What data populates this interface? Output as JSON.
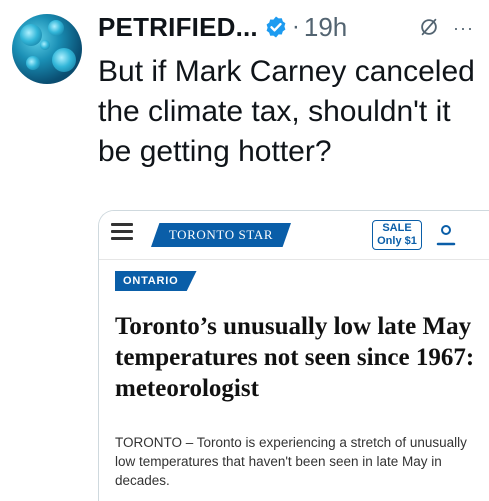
{
  "tweet": {
    "display_name": "PETRIFIED...",
    "separator": "·",
    "timestamp": "19h",
    "more_label": "···",
    "text": "But if Mark Carney canceled the climate tax, shouldn't it be getting hotter?"
  },
  "card": {
    "masthead": "TORONTO STAR",
    "sale_line1": "SALE",
    "sale_line2": "Only $1",
    "section": "ONTARIO",
    "headline": "Toronto’s unusually low late May temperatures not seen since 1967: meteorologist",
    "summary": "TORONTO – Toronto is experiencing a stretch of unusually low temperatures that haven't been seen in late May in decades."
  },
  "colors": {
    "verified_blue": "#1d9bf0",
    "star_blue": "#0a5ea8",
    "secondary_text": "#536471"
  },
  "icons": {
    "avatar": "virus-avatar",
    "verified": "verified-badge-icon",
    "grok": "grok-icon",
    "menu": "hamburger-menu-icon",
    "account": "account-icon"
  }
}
